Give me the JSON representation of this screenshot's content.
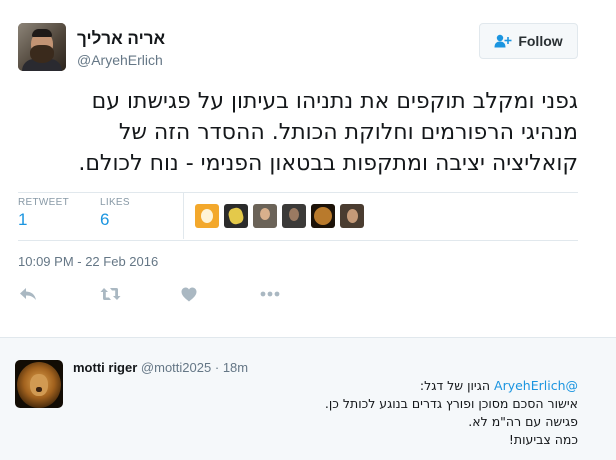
{
  "author": {
    "display_name": "אריה ארליך",
    "handle": "@AryehErlich"
  },
  "follow_button": {
    "label": "Follow",
    "icon": "follow-user-plus-icon"
  },
  "tweet": {
    "lines": [
      "גפני ומקלב תוקפים את נתניהו בעיתון על פגישתו עם",
      "מנהיגי הרפורמים וחלוקת הכותל. ההסדר הזה של",
      "קואליציה יציבה ומתקפות בבטאון הפנימי - נוח לכולם."
    ],
    "timestamp": "10:09 PM - 22 Feb 2016"
  },
  "stats": {
    "retweets_label": "RETWEET",
    "retweets_count": "1",
    "likes_label": "LIKES",
    "likes_count": "6"
  },
  "likers": [
    "liker-avatar-1",
    "liker-avatar-2",
    "liker-avatar-3",
    "liker-avatar-4",
    "liker-avatar-5",
    "liker-avatar-6"
  ],
  "actions": [
    "reply-icon",
    "retweet-icon",
    "like-heart-icon",
    "more-dots-icon"
  ],
  "reply": {
    "name": "motti riger",
    "handle": "@motti2025",
    "separator": "·",
    "time": "18m",
    "mention": "@AryehErlich",
    "first_line_rest": " הגיון של דגל:",
    "lines": [
      "אישור הסכם מסוכן ופורץ גדרים בנוגע לכותל כן.",
      "פגישה עם רה\"מ לא.",
      "כמה צביעות!"
    ]
  },
  "colors": {
    "accent": "#1b95e0",
    "muted": "#657786",
    "border": "#e1e8ed",
    "reply_bg": "#f5f8fa"
  }
}
